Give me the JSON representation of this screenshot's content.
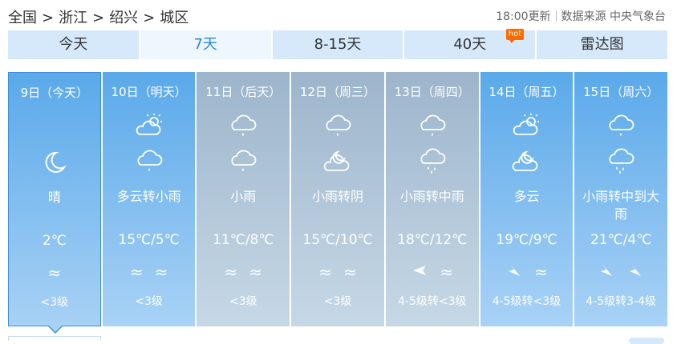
{
  "breadcrumb": {
    "items": [
      "全国",
      "浙江",
      "绍兴",
      "城区"
    ],
    "separator": ">"
  },
  "meta": {
    "update_time": "18:00更新",
    "source": "数据来源 中央气象台"
  },
  "tabs": [
    {
      "label": "今天",
      "active": false
    },
    {
      "label": "7天",
      "active": true
    },
    {
      "label": "8-15天",
      "active": false
    },
    {
      "label": "40天",
      "active": false,
      "badge": "hot"
    },
    {
      "label": "雷达图",
      "active": false
    }
  ],
  "days": [
    {
      "date": "9日（今天）",
      "icon1": "none-icon",
      "icon2": "moon-icon",
      "condition": "晴",
      "temp": "2℃",
      "wind": [
        "≈"
      ],
      "wind_level": "<3级",
      "style": "today"
    },
    {
      "date": "10日（明天）",
      "icon1": "partly-cloudy-icon",
      "icon2": "light-rain-icon",
      "condition": "多云转小雨",
      "temp": "15℃/5℃",
      "wind": [
        "≈",
        "≈"
      ],
      "wind_level": "<3级",
      "style": "sunny-blue"
    },
    {
      "date": "11日（后天）",
      "icon1": "light-rain-icon",
      "icon2": "light-rain-icon",
      "condition": "小雨",
      "temp": "11℃/8℃",
      "wind": [
        "≈",
        "≈"
      ],
      "wind_level": "<3级",
      "style": "gray"
    },
    {
      "date": "12日（周三）",
      "icon1": "light-rain-icon",
      "icon2": "cloudy-night-icon",
      "condition": "小雨转阴",
      "temp": "15℃/10℃",
      "wind": [
        "≈",
        "≈"
      ],
      "wind_level": "<3级",
      "style": "gray"
    },
    {
      "date": "13日（周四）",
      "icon1": "light-rain-icon",
      "icon2": "moderate-rain-icon",
      "condition": "小雨转中雨",
      "temp": "18℃/12℃",
      "wind": [
        "arrow-left",
        "≈"
      ],
      "wind_level": "4-5级转<3级",
      "style": "gray"
    },
    {
      "date": "14日（周五）",
      "icon1": "partly-cloudy-icon",
      "icon2": "cloudy-night-icon",
      "condition": "多云",
      "temp": "19℃/9℃",
      "wind": [
        "arrow-down-right",
        "≈"
      ],
      "wind_level": "4-5级转<3级",
      "style": "sunny-blue"
    },
    {
      "date": "15日（周六）",
      "icon1": "light-rain-icon",
      "icon2": "moderate-rain-icon",
      "condition": "小雨转中到大雨",
      "temp": "21℃/4℃",
      "wind": [
        "arrow-down-right",
        "arrow-down-right"
      ],
      "wind_level": "4-5级转3-4级",
      "style": "sunny-blue"
    }
  ]
}
